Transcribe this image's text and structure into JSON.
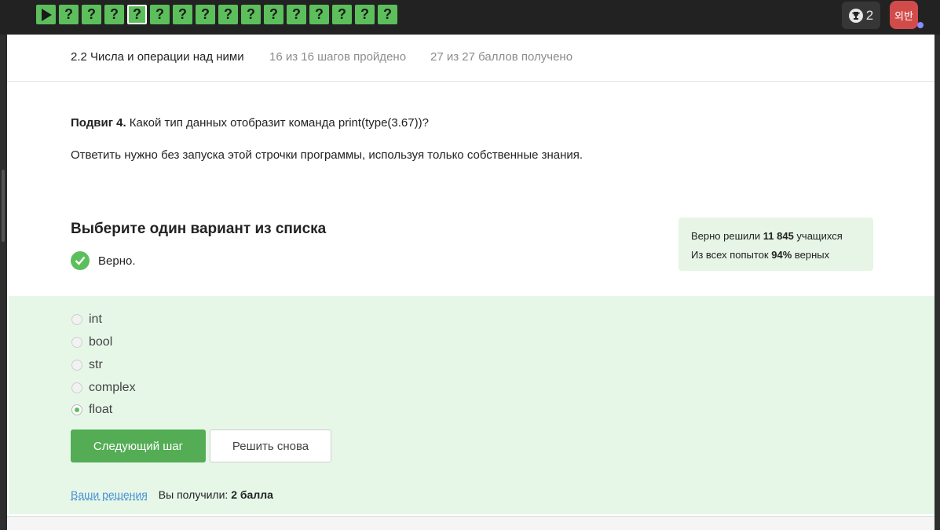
{
  "step_bar": {
    "first_icon": "play-icon",
    "step_labels": [
      "?",
      "?",
      "?",
      "?",
      "?",
      "?",
      "?",
      "?",
      "?",
      "?",
      "?",
      "?",
      "?",
      "?",
      "?"
    ],
    "current_index": 3,
    "color": "#5cbf5c"
  },
  "header": {
    "trophy_icon": "trophy-icon",
    "trophy_count": "2",
    "avatar_text": "외반",
    "avatar_color": "#d24b4b"
  },
  "lesson": {
    "title": "2.2 Числа и операции над ними",
    "steps_progress": "16 из 16 шагов пройдено",
    "score_progress": "27 из 27 баллов  получено"
  },
  "question": {
    "bold_prefix": "Подвиг 4.",
    "text": " Какой тип данных отобразит команда print(type(3.67))?",
    "note": "Ответить нужно без запуска этой строчки программы, используя только собственные знания."
  },
  "quiz": {
    "heading": "Выберите один вариант из списка",
    "verdict_icon": "check-circle-icon",
    "verdict": "Верно.",
    "options": [
      {
        "label": "int",
        "checked": false
      },
      {
        "label": "bool",
        "checked": false
      },
      {
        "label": "str",
        "checked": false
      },
      {
        "label": "complex",
        "checked": false
      },
      {
        "label": "float",
        "checked": true
      }
    ],
    "next_button": "Следующий шаг",
    "retry_button": "Решить снова"
  },
  "stats": {
    "line1_prefix": "Верно решили ",
    "line1_value": "11 845",
    "line1_suffix": " учащихся",
    "line2_prefix": "Из всех попыток ",
    "line2_value": "94%",
    "line2_suffix": " верных"
  },
  "footer": {
    "solutions_link": "Ваши решения",
    "received_prefix": "Вы получили: ",
    "received_value": "2 балла"
  },
  "colors": {
    "accent_green": "#54ad54",
    "answer_bg": "#e6f7e8",
    "stats_bg": "#e6f5e6",
    "link": "#4a8fd4"
  }
}
